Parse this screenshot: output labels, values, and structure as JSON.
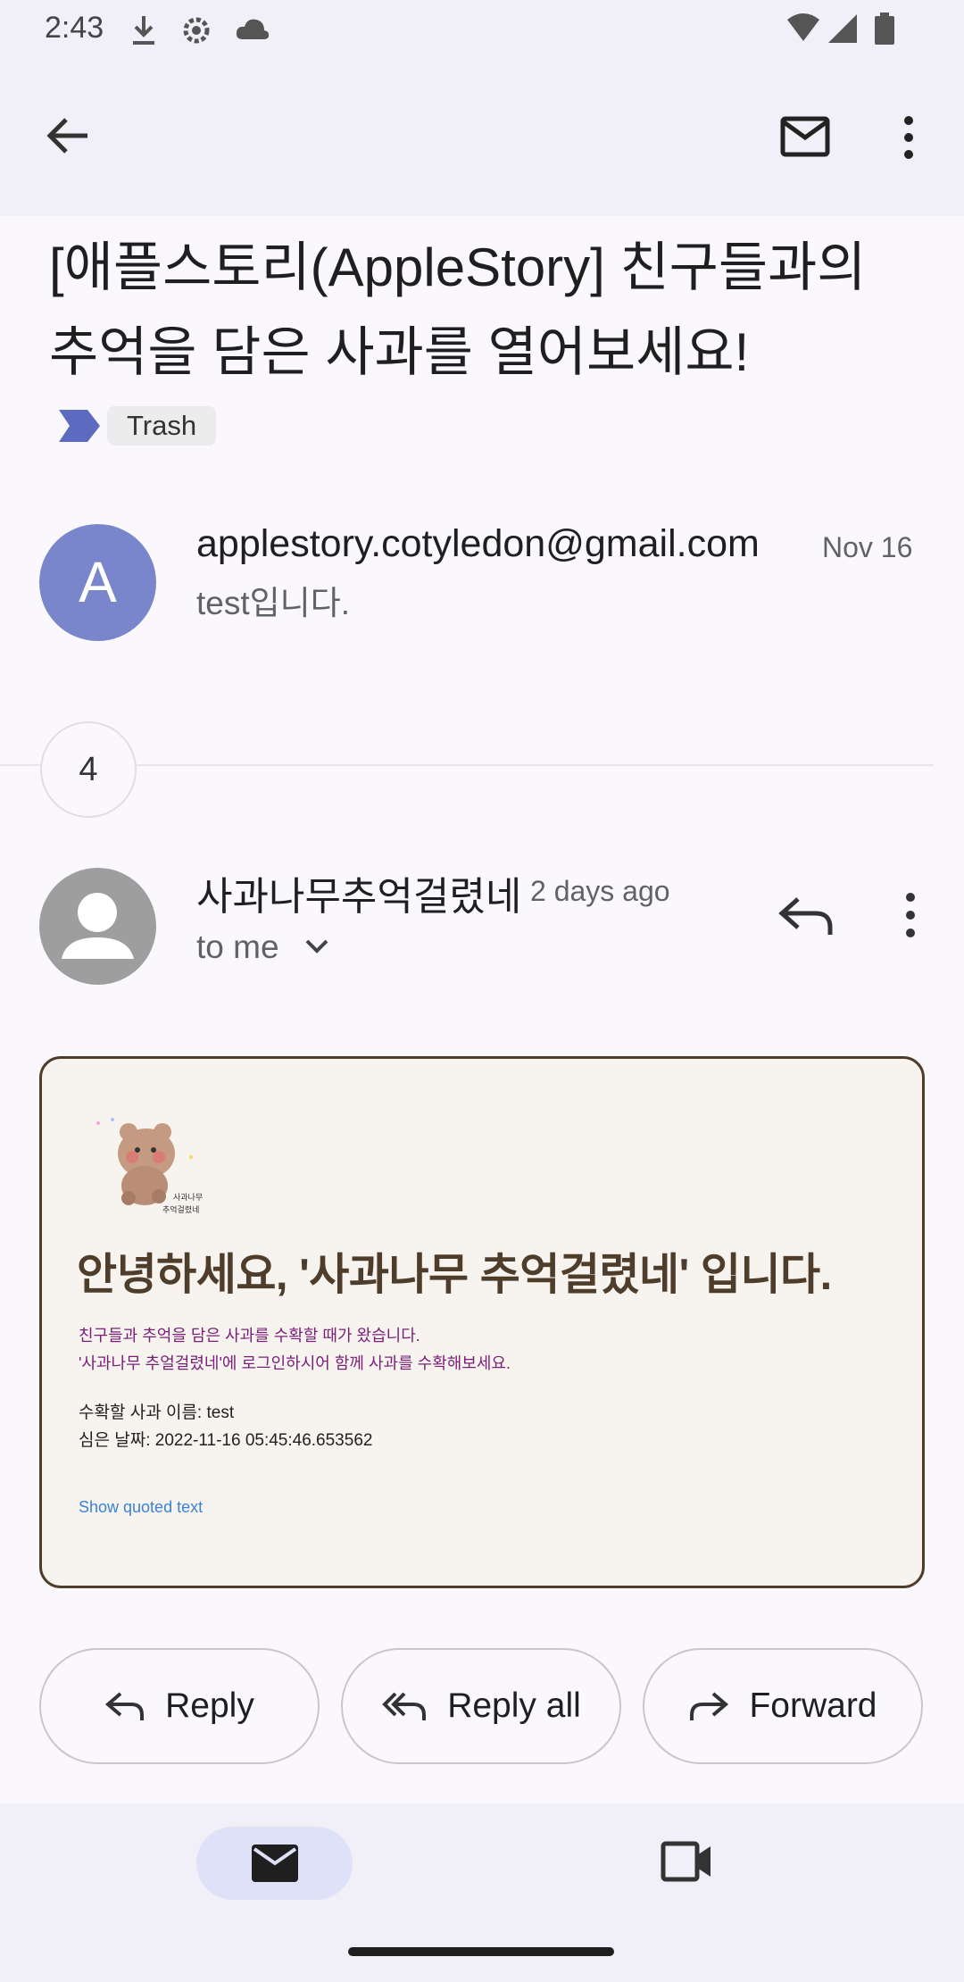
{
  "status_bar": {
    "time": "2:43"
  },
  "subject": "[애플스토리(AppleStory] 친구들과의 추억을 담은 사과를 열어보세요!",
  "label": "Trash",
  "messages": [
    {
      "avatar_letter": "A",
      "sender": "applestory.cotyledon@gmail.com",
      "date": "Nov 16",
      "snippet": "test입니다."
    }
  ],
  "collapsed_count": "4",
  "expanded_message": {
    "sender": "사과나무추억걸렸네",
    "date": "2 days ago",
    "recipient": "to me",
    "body": {
      "logo_text": "사과나무 추억걸렸네",
      "heading": "안녕하세요, '사과나무 추억걸렸네' 입니다.",
      "line1": "친구들과 추억을 담은 사과를 수확할 때가 왔습니다.",
      "line2": "'사과나무 추얼걸렸네'에 로그인하시어 함께 사과를 수확해보세요.",
      "apple_name": "수확할 사과 이름: test",
      "planted_date": "심은 날짜: 2022-11-16 05:45:46.653562",
      "show_quoted": "Show quoted text"
    }
  },
  "actions": {
    "reply": "Reply",
    "reply_all": "Reply all",
    "forward": "Forward"
  },
  "colors": {
    "accent": "#7986cb",
    "card_border": "#4e3d2a",
    "purple_text": "#7a1f78",
    "link": "#3b82d6"
  }
}
